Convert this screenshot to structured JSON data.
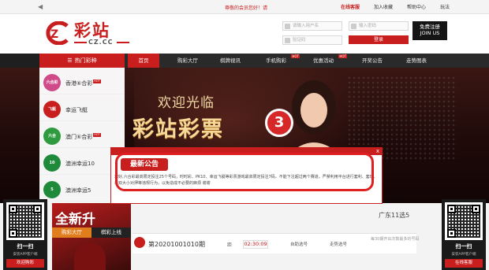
{
  "topbar": {
    "notice": "尊敬的会员您好！请",
    "links": [
      "在线客服",
      "加入收藏",
      "帮助中心",
      "玩法"
    ]
  },
  "header": {
    "logo_cn": "彩站",
    "logo_en": "CZ.CC",
    "username_placeholder": "请输入用户名",
    "password_placeholder": "输入密码",
    "captcha_placeholder": "验证码",
    "login_label": "登录",
    "register_line1": "免费注册",
    "register_line2": "JOIN US"
  },
  "nav": {
    "hot_label": "热门彩种",
    "items": [
      {
        "label": "首页",
        "badge": ""
      },
      {
        "label": "购彩大厅",
        "badge": ""
      },
      {
        "label": "棋牌视讯",
        "badge": ""
      },
      {
        "label": "手机购彩",
        "badge": "HOT"
      },
      {
        "label": "优惠活动",
        "badge": "HOT"
      },
      {
        "label": "开奖公告",
        "badge": ""
      },
      {
        "label": "走势图表",
        "badge": ""
      }
    ]
  },
  "lotteries": [
    {
      "name": "香港⑥合彩",
      "icon": "六合彩",
      "color": "#d04a8a",
      "hot": "HOT"
    },
    {
      "name": "幸运飞艇",
      "icon": "飞艇",
      "color": "#c81e1e",
      "hot": ""
    },
    {
      "name": "澳门⑥合彩",
      "icon": "六合",
      "color": "#2e9b3e",
      "hot": "HOT"
    },
    {
      "name": "澳洲幸运10",
      "icon": "10",
      "color": "#1f8a3a",
      "hot": ""
    },
    {
      "name": "澳洲幸运5",
      "icon": "5",
      "color": "#1f8a3a",
      "hot": ""
    }
  ],
  "banner": {
    "welcome": "欢迎光临",
    "brand": "彩站彩票",
    "ball": "3"
  },
  "popup": {
    "title": "最新公告",
    "close": "x",
    "body": "您好,六合彩最高限定投注25个号码，时时彩、PK10、幸运飞艇等彩票游戏最高限定投注7码，不能下注超过两个赛道。严禁利用平台进行套利、套现、单双大小对押等违规行为，以免造成不必要的麻烦 谢谢"
  },
  "promo": {
    "big": "全新升",
    "left": "购彩大厅",
    "right": "棋彩上线"
  },
  "ticker": {
    "period": "第20201001010期",
    "time_label": "距",
    "time": "02:30:09",
    "col1": "自助选号",
    "col2": "走势选号"
  },
  "draw": {
    "title": "广东11选5",
    "sub": "每30期开出次数最多的号码"
  },
  "qr_left": {
    "scan": "扫一扫",
    "sub": "安装APP客户端",
    "button": "欢迎购彩"
  },
  "qr_right": {
    "scan": "扫一扫",
    "sub": "安装APP客户端",
    "button": "在线客服"
  }
}
